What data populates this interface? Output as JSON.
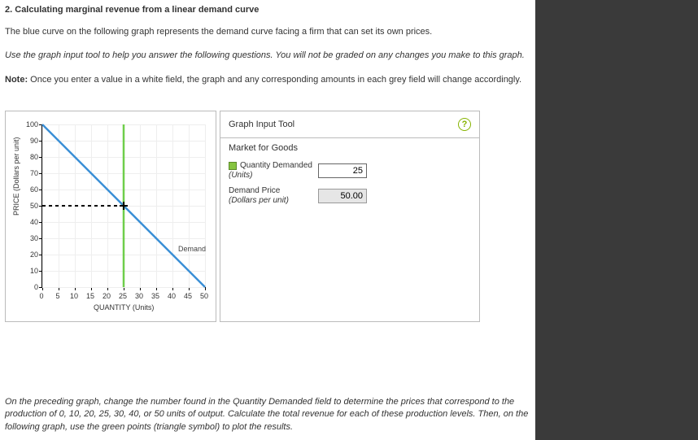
{
  "question": {
    "number": "2.",
    "title": "Calculating marginal revenue from a linear demand curve"
  },
  "intro": "The blue curve on the following graph represents the demand curve facing a firm that can set its own prices.",
  "instruction": "Use the graph input tool to help you answer the following questions. You will not be graded on any changes you make to this graph.",
  "note_label": "Note:",
  "note_text": "Once you enter a value in a white field, the graph and any corresponding amounts in each grey field will change accordingly.",
  "graph_tool": {
    "title": "Graph Input Tool",
    "market_label": "Market for Goods",
    "row1_label": "Quantity Demanded",
    "row1_sublabel": "(Units)",
    "quantity": "25",
    "row2_label": "Demand Price",
    "row2_sublabel": "(Dollars per unit)",
    "price": "50.00"
  },
  "bottom_instruction": "On the preceding graph, change the number found in the Quantity Demanded field to determine the prices that correspond to the production of 0, 10, 20, 25, 30, 40, or 50 units of output. Calculate the total revenue for each of these production levels. Then, on the following graph, use the green points (triangle symbol) to plot the results.",
  "chart_data": {
    "type": "line",
    "title": "",
    "xlabel": "QUANTITY (Units)",
    "ylabel": "PRICE (Dollars per unit)",
    "xlim": [
      0,
      50
    ],
    "ylim": [
      0,
      100
    ],
    "x_ticks": [
      0,
      5,
      10,
      15,
      20,
      25,
      30,
      35,
      40,
      45,
      50
    ],
    "y_ticks": [
      0,
      10,
      20,
      30,
      40,
      50,
      60,
      70,
      80,
      90,
      100
    ],
    "series": [
      {
        "name": "Demand",
        "color": "#3a8fd6",
        "x": [
          0,
          50
        ],
        "y": [
          100,
          0
        ]
      },
      {
        "name": "quantity-marker",
        "color": "#6fce4a",
        "x": [
          25,
          25
        ],
        "y": [
          0,
          100
        ]
      },
      {
        "name": "price-marker-dashed",
        "color": "#000000",
        "x": [
          0,
          25
        ],
        "y": [
          50,
          50
        ]
      }
    ],
    "marker_point": {
      "x": 25,
      "y": 50
    },
    "demand_legend": "Demand"
  }
}
